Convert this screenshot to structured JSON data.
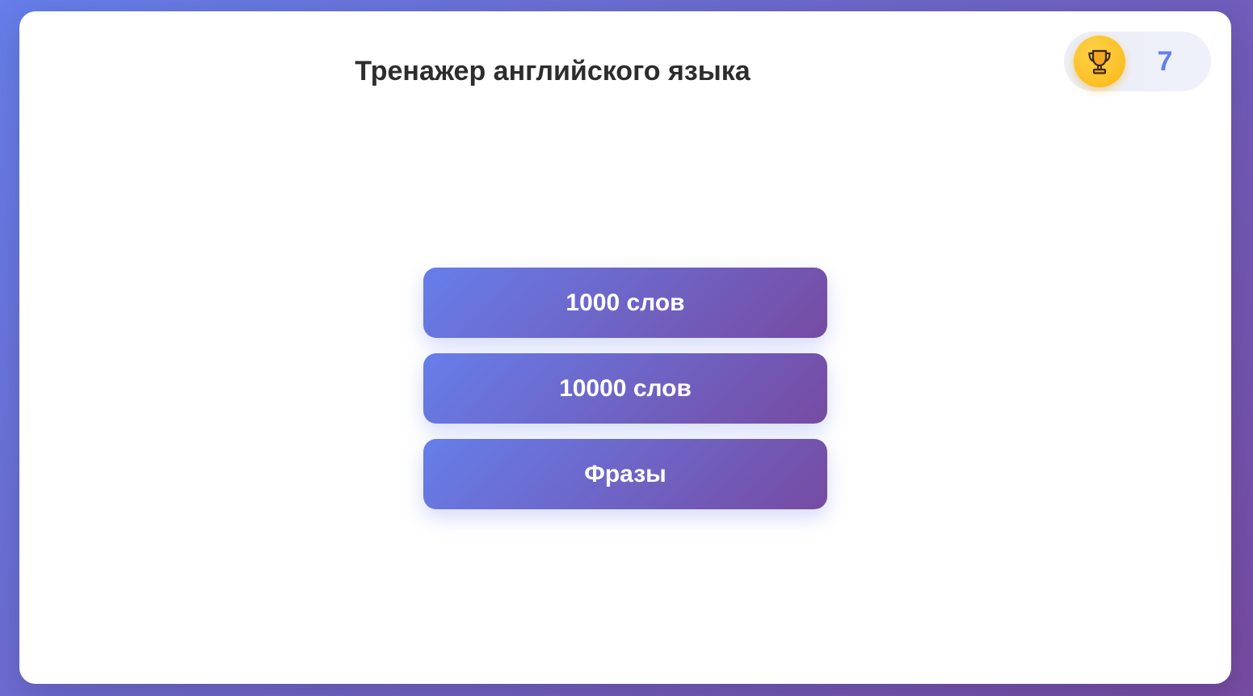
{
  "header": {
    "title": "Тренажер английского языка"
  },
  "score": {
    "icon": "trophy-icon",
    "value": "7"
  },
  "menu": {
    "items": [
      {
        "label": "1000 слов"
      },
      {
        "label": "10000 слов"
      },
      {
        "label": "Фразы"
      }
    ]
  },
  "colors": {
    "gradient_start": "#667eea",
    "gradient_end": "#764ba2",
    "trophy_bg": "#fbbf24",
    "score_text": "#667eea",
    "title_text": "#2d2d2d"
  }
}
